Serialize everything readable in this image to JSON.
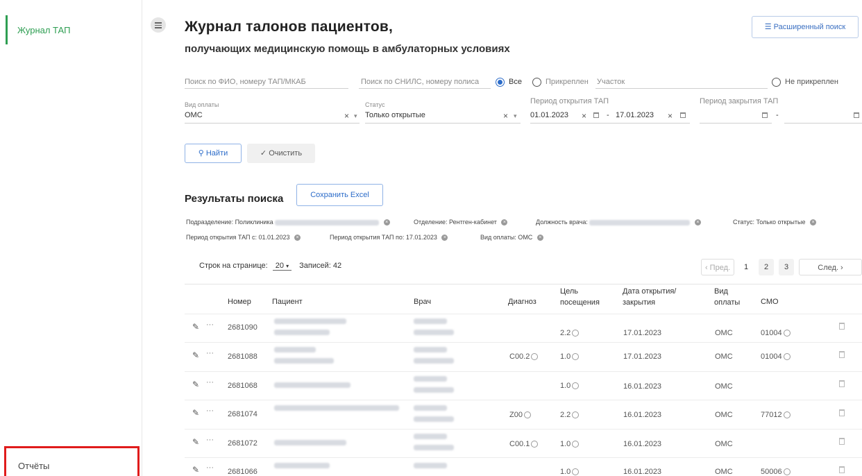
{
  "sidebar": {
    "active_item": "Журнал ТАП",
    "reports_item": "Отчёты"
  },
  "header": {
    "title": "Журнал талонов пациентов,",
    "subtitle": "получающих медицинскую помощь в амбулаторных условиях",
    "advanced_search": "☰ Расширенный поиск"
  },
  "filters": {
    "fio_placeholder": "Поиск по ФИО, номеру ТАП/МКАБ",
    "snils_placeholder": "Поиск по СНИЛС, номеру полиса",
    "radio_all": "Все",
    "radio_attached": "Прикреплен",
    "district_placeholder": "Участок",
    "radio_not_attached": "Не прикреплен",
    "payment_label": "Вид оплаты",
    "payment_value": "ОМС",
    "status_label": "Статус",
    "status_value": "Только открытые",
    "open_period_label": "Период открытия ТАП",
    "open_from": "01.01.2023",
    "open_to": "17.01.2023",
    "close_period_label": "Период закрытия ТАП",
    "dash": "-",
    "clear_x": "×",
    "dropdown_arrow": "▾"
  },
  "actions": {
    "find": "Найти",
    "clear": "Очистить"
  },
  "results": {
    "title": "Результаты поиска",
    "save_excel": "Сохранить Excel",
    "chips_row1": [
      "Подразделение: Поликлиника",
      "Отделение: Рентген-кабинет",
      "Должность врача:",
      "Статус: Только открытые"
    ],
    "chips_row2": [
      "Период открытия ТАП с: 01.01.2023",
      "Период открытия ТАП по: 17.01.2023",
      "Вид оплаты: ОМС"
    ]
  },
  "pagination": {
    "rows_label": "Строк на странице:",
    "rows_value": "20",
    "records_label": "Записей:",
    "records_value": "42",
    "prev": "‹ Пред.",
    "pages": [
      "1",
      "2",
      "3"
    ],
    "next": "След. ›"
  },
  "table": {
    "headers": {
      "number": "Номер",
      "patient": "Пациент",
      "doctor": "Врач",
      "diagnosis": "Диагноз",
      "purpose_1": "Цель",
      "purpose_2": "посещения",
      "dates_1": "Дата открытия/",
      "dates_2": "закрытия",
      "payment_1": "Вид",
      "payment_2": "оплаты",
      "smo": "СМО"
    },
    "rows": [
      {
        "number": "2681090",
        "diagnosis": "",
        "purpose": "2.2",
        "date": "17.01.2023",
        "payment": "ОМС",
        "smo": "01004"
      },
      {
        "number": "2681088",
        "diagnosis": "C00.2",
        "purpose": "1.0",
        "date": "17.01.2023",
        "payment": "ОМС",
        "smo": "01004"
      },
      {
        "number": "2681068",
        "diagnosis": "",
        "purpose": "1.0",
        "date": "16.01.2023",
        "payment": "ОМС",
        "smo": ""
      },
      {
        "number": "2681074",
        "diagnosis": "Z00",
        "purpose": "2.2",
        "date": "16.01.2023",
        "payment": "ОМС",
        "smo": "77012"
      },
      {
        "number": "2681072",
        "diagnosis": "C00.1",
        "purpose": "1.0",
        "date": "16.01.2023",
        "payment": "ОМС",
        "smo": ""
      },
      {
        "number": "2681066",
        "diagnosis": "",
        "purpose": "1.0",
        "date": "16.01.2023",
        "payment": "ОМС",
        "smo": "50006"
      }
    ]
  }
}
